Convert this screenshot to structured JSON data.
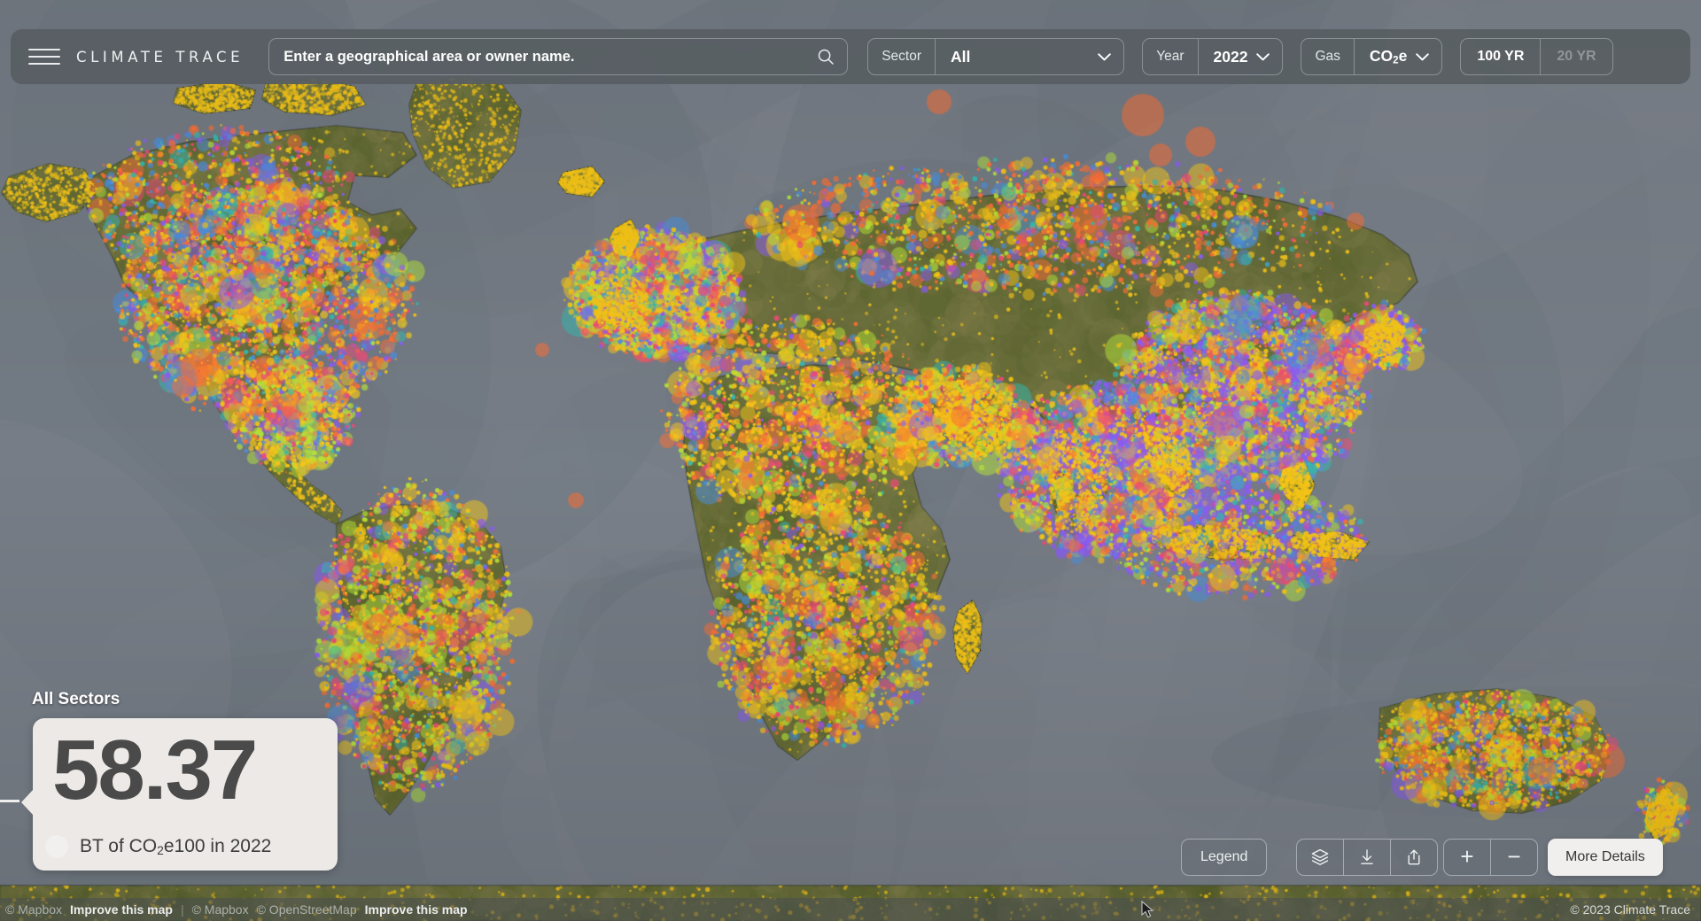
{
  "header": {
    "menu_icon": "hamburger-menu-icon",
    "brand": "CLIMATE TRACE",
    "search": {
      "placeholder": "Enter a geographical area or owner name.",
      "value": "",
      "icon": "search-icon"
    },
    "sector": {
      "label": "Sector",
      "value": "All",
      "icon": "chevron-down-icon"
    },
    "year": {
      "label": "Year",
      "value": "2022",
      "icon": "chevron-down-icon"
    },
    "gas": {
      "label": "Gas",
      "value_prefix": "CO",
      "value_sub": "2",
      "value_suffix": "e",
      "icon": "chevron-down-icon"
    },
    "horizon": {
      "option_active": "100 YR",
      "option_inactive": "20 YR",
      "selected": "100 YR"
    }
  },
  "stats": {
    "caption": "All Sectors",
    "value": "58.37",
    "unit_prefix": "BT of CO",
    "unit_sub": "2",
    "unit_suffix": "e100 in 2022",
    "dot_color": "#f2f0ee"
  },
  "map_controls": {
    "legend": "Legend",
    "layers_icon": "layers-stack-icon",
    "download_icon": "download-arrow-icon",
    "share_icon": "share-upload-icon",
    "zoom_in": "+",
    "zoom_out": "−",
    "more_details": "More Details"
  },
  "attribution": {
    "mapbox_1": "© Mapbox",
    "improve_1": "Improve this map",
    "mapbox_2": "© Mapbox",
    "osm": "© OpenStreetMap",
    "improve_2": "Improve this map",
    "copyright": "© 2023 Climate Trace"
  },
  "palette": {
    "ocean": "#767d86",
    "ocean_deep": "#6e757e",
    "land": "#6b6f3c",
    "land_light": "#767a46",
    "header_bg": "#585f63",
    "card_bg": "#ece9e6",
    "dot_purple": "#8b5cf6",
    "dot_orange": "#f97036",
    "dot_yellow": "#f5c518",
    "dot_green": "#b4e33a",
    "dot_blue": "#4a8fe0",
    "dot_pink": "#ef4a78",
    "dot_teal": "#35b8b0"
  }
}
